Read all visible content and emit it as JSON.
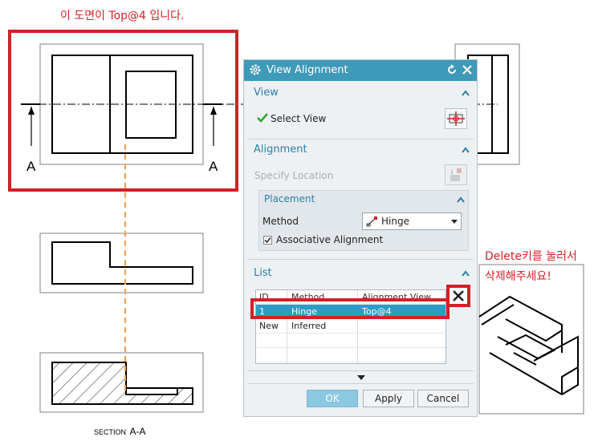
{
  "annotations": {
    "top_note": "이 도면이 Top@4 입니다.",
    "delete_note_line1": "Delete키를 눌러서",
    "delete_note_line2": "삭제해주세요!",
    "section_label_small": "SECTION",
    "section_label": "A-A",
    "arrow_label_left": "A",
    "arrow_label_right": "A"
  },
  "dialog": {
    "title": "View Alignment",
    "view": {
      "heading": "View",
      "select_view_label": "Select View"
    },
    "alignment": {
      "heading": "Alignment",
      "specify_location_label": "Specify Location",
      "placement": {
        "heading": "Placement",
        "method_label": "Method",
        "method_value": "Hinge",
        "associative_label": "Associative Alignment",
        "associative_checked": true
      }
    },
    "list": {
      "heading": "List",
      "columns": [
        "ID",
        "Method",
        "Alignment View"
      ],
      "rows": [
        {
          "id": "1",
          "method": "Hinge",
          "view": "Top@4"
        },
        {
          "id": "New",
          "method": "Inferred",
          "view": ""
        }
      ]
    },
    "buttons": {
      "ok": "OK",
      "apply": "Apply",
      "cancel": "Cancel"
    }
  },
  "colors": {
    "highlight_red": "#d32027",
    "title_blue": "#3f99b8",
    "heading_blue": "#2e7fa8",
    "selected_row": "#2f9bc5",
    "orange_dash": "#f0a050"
  }
}
